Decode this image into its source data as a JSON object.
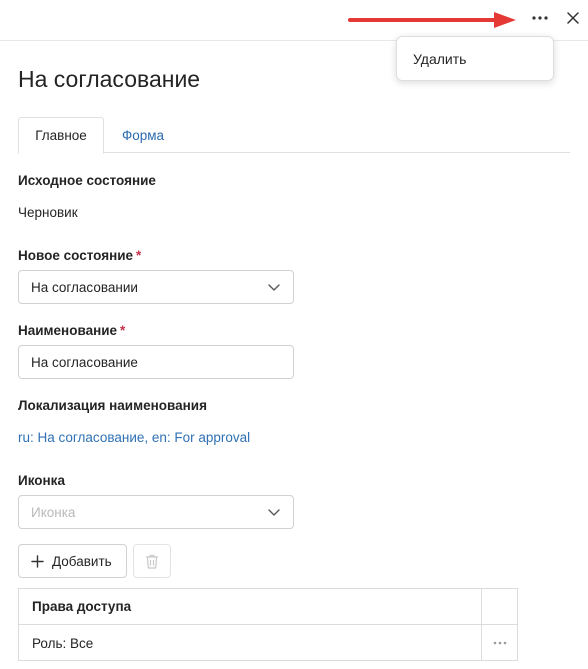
{
  "header": {
    "more_icon": "more-horizontal-icon",
    "close_icon": "close-icon",
    "annotation_arrow_color": "#e53935"
  },
  "menu": {
    "items": [
      {
        "label": "Удалить"
      }
    ]
  },
  "page": {
    "title": "На согласование"
  },
  "tabs": [
    {
      "label": "Главное",
      "active": true
    },
    {
      "label": "Форма",
      "active": false
    }
  ],
  "form": {
    "source_state": {
      "label": "Исходное состояние",
      "value": "Черновик"
    },
    "new_state": {
      "label": "Новое состояние",
      "required_mark": "*",
      "value": "На согласовании"
    },
    "name": {
      "label": "Наименование",
      "required_mark": "*",
      "value": "На согласование"
    },
    "name_localization": {
      "label": "Локализация наименования",
      "value": "ru: На согласование, en: For approval"
    },
    "icon": {
      "label": "Иконка",
      "placeholder": "Иконка"
    }
  },
  "toolbar": {
    "add_label": "Добавить",
    "add_icon": "plus-icon",
    "delete_icon": "trash-icon"
  },
  "access_table": {
    "columns": [
      "Права доступа"
    ],
    "rows": [
      {
        "role": "Роль: Все"
      }
    ]
  },
  "colors": {
    "link": "#2f71b5",
    "required": "#c4314b"
  }
}
